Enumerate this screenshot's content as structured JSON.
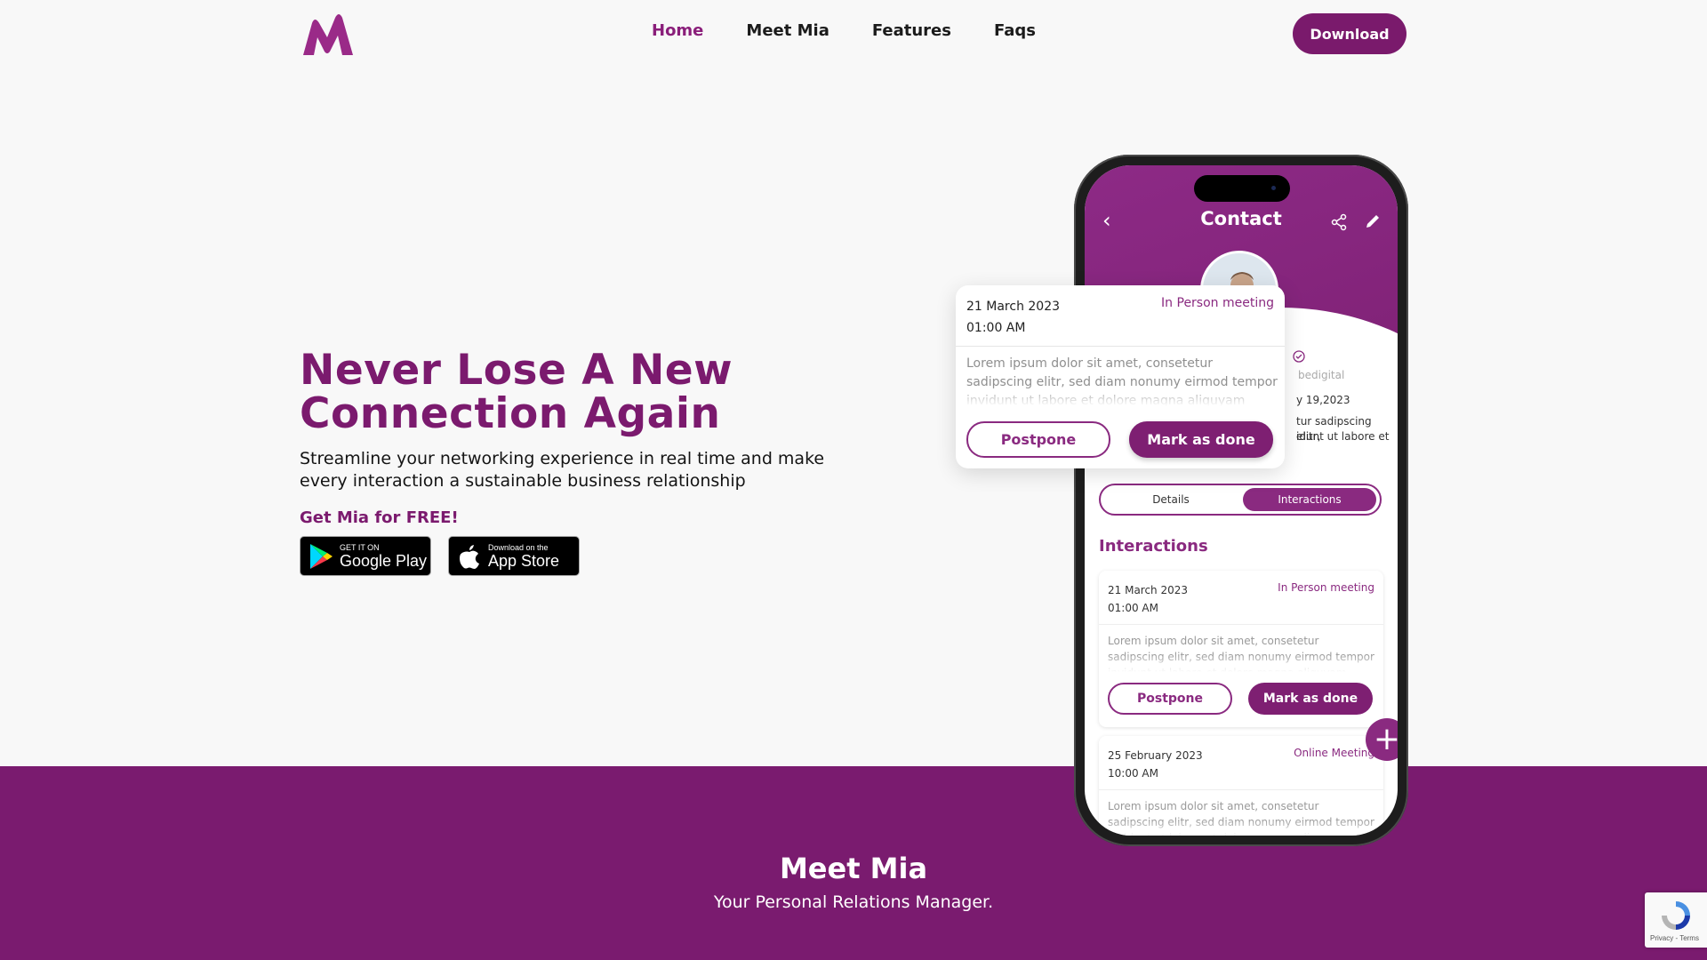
{
  "nav": {
    "links": [
      "Home",
      "Meet Mia",
      "Features",
      "Faqs"
    ],
    "active": "Home",
    "download_label": "Download"
  },
  "hero": {
    "title": "Never Lose A New Connection Again",
    "subtitle": "Streamline your networking experience in real time and make every interaction a sustainable business relationship",
    "free_label": "Get Mia for FREE!",
    "google_play": {
      "small": "GET IT ON",
      "big": "Google Play"
    },
    "app_store": {
      "small": "Download on the",
      "big": "App Store"
    }
  },
  "phone": {
    "screen_title": "Contact",
    "partial_texts": [
      "bedigital",
      "y 19,2023",
      "tur sadipscing elitr,",
      "idunt ut labore et"
    ],
    "tabs": [
      "Details",
      "Interactions"
    ],
    "active_tab": "Interactions",
    "section_title": "Interactions",
    "cards": [
      {
        "date": "21 March 2023",
        "time": "01:00 AM",
        "type": "In Person meeting",
        "body": "Lorem ipsum dolor sit amet, consetetur sadipscing elitr, sed diam nonumy eirmod tempor invidunt ut labore et dolore magna aliquyam erat.",
        "postpone": "Postpone",
        "done": "Mark as done"
      },
      {
        "date": "25 February 2023",
        "time": "10:00 AM",
        "type": "Online Meeting",
        "body": "Lorem ipsum dolor sit amet, consetetur sadipscing elitr, sed diam nonumy eirmod tempor invidunt ut labore et dolore magna aliquyam erat."
      }
    ]
  },
  "popup": {
    "date": "21 March 2023",
    "time": "01:00 AM",
    "type": "In Person meeting",
    "body": "Lorem ipsum dolor sit amet, consetetur sadipscing elitr, sed diam nonumy eirmod tempor invidunt ut labore et dolore magna aliquyam erat.",
    "postpone": "Postpone",
    "done": "Mark as done"
  },
  "meet": {
    "title": "Meet Mia",
    "subtitle": "Your Personal Relations Manager."
  },
  "recaptcha": {
    "text": "Privacy - Terms"
  },
  "colors": {
    "brand": "#7a1b6f",
    "accent": "#8a2a80",
    "background": "#f8f8f8"
  }
}
